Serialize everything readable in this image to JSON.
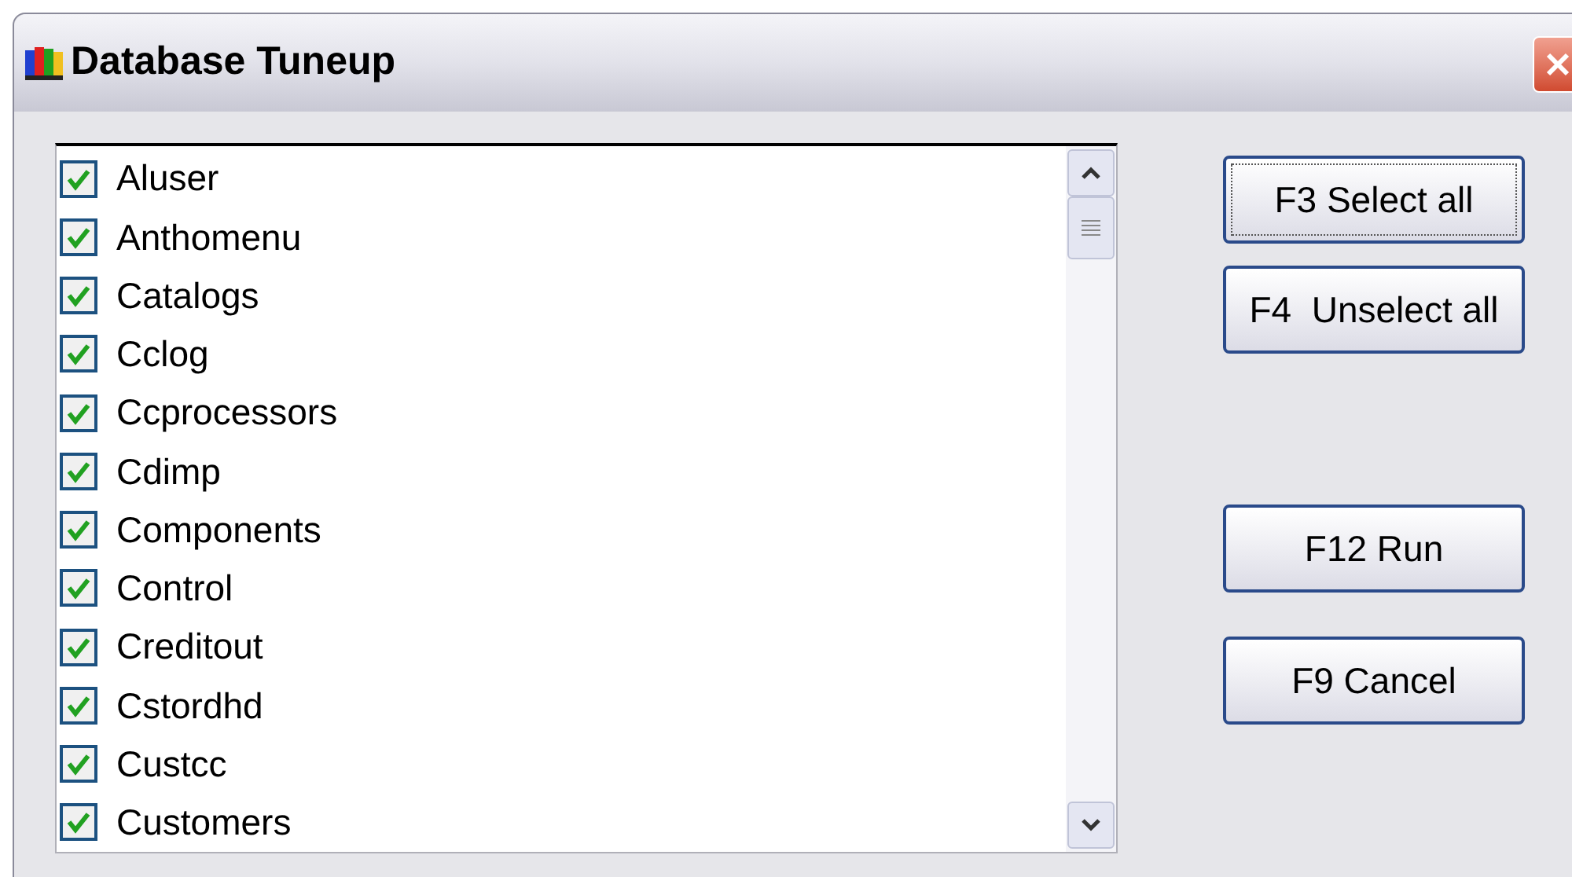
{
  "window": {
    "title": "Database Tuneup"
  },
  "tables": [
    {
      "name": "Aluser",
      "checked": true
    },
    {
      "name": "Anthomenu",
      "checked": true
    },
    {
      "name": "Catalogs",
      "checked": true
    },
    {
      "name": "Cclog",
      "checked": true
    },
    {
      "name": "Ccprocessors",
      "checked": true
    },
    {
      "name": "Cdimp",
      "checked": true
    },
    {
      "name": "Components",
      "checked": true
    },
    {
      "name": "Control",
      "checked": true
    },
    {
      "name": "Creditout",
      "checked": true
    },
    {
      "name": "Cstordhd",
      "checked": true
    },
    {
      "name": "Custcc",
      "checked": true
    },
    {
      "name": "Customers",
      "checked": true
    }
  ],
  "buttons": [
    {
      "label": "F3 Select all",
      "focused": true
    },
    {
      "label": "F4  Unselect all",
      "focused": false
    },
    {
      "label": "F12 Run",
      "focused": false
    },
    {
      "label": "F9 Cancel",
      "focused": false
    }
  ]
}
